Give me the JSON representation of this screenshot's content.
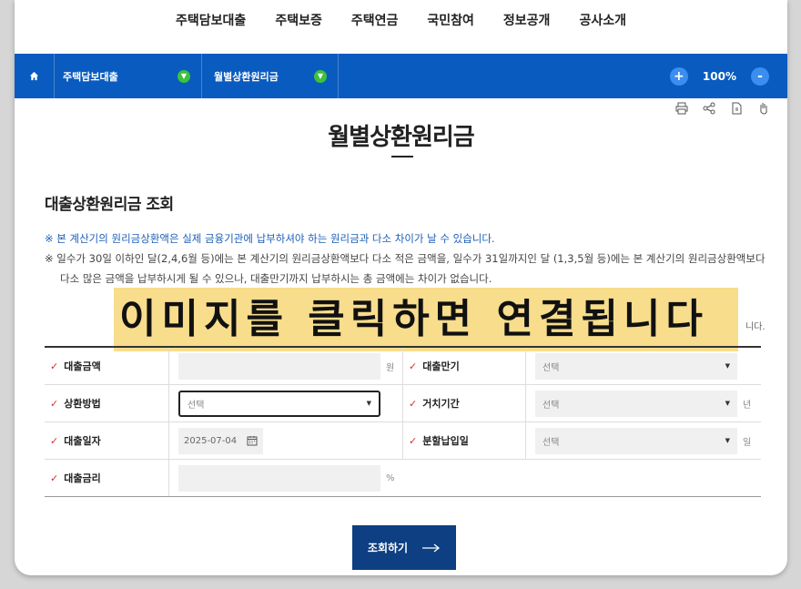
{
  "topnav": [
    "주택담보대출",
    "주택보증",
    "주택연금",
    "국민참여",
    "정보공개",
    "공사소개"
  ],
  "breadcrumb": {
    "item1": "주택담보대출",
    "item2": "월별상환원리금"
  },
  "zoom": {
    "level": "100%",
    "plus": "+",
    "minus": "-"
  },
  "page_title": "월별상환원리금",
  "section_title": "대출상환원리금 조회",
  "notes": {
    "note1": "※ 본 계산기의 원리금상환액은 실제 금융기관에 납부하셔야 하는 원리금과 다소 차이가 날 수 있습니다.",
    "note2_line1": "※ 일수가 30일 이하인 달(2,4,6월 등)에는 본 계산기의 원리금상환액보다 다소 적은 금액을, 일수가 31일까지인 달 (1,3,5월 등)에는 본 계산기의 원리금상환액보다",
    "note2_line2": "다소 많은 금액을 납부하시게 될 수 있으나, 대출만기까지 납부하시는 총 금액에는 차이가 없습니다."
  },
  "banner_text": "이미지를 클릭하면 연결됩니다",
  "behind_banner_tail": "니다.",
  "form": {
    "loan_amount_label": "대출금액",
    "loan_amount_unit": "원",
    "loan_term_label": "대출만기",
    "loan_term_value": "선택",
    "repay_method_label": "상환방법",
    "repay_method_value": "선택",
    "grace_label": "거치기간",
    "grace_value": "선택",
    "grace_unit": "년",
    "loan_date_label": "대출일자",
    "loan_date_value": "2025-07-04",
    "pay_day_label": "분할납입일",
    "pay_day_value": "선택",
    "pay_day_unit": "일",
    "rate_label": "대출금리",
    "rate_unit": "%"
  },
  "submit_label": "조회하기",
  "icons": [
    "home-icon",
    "print-icon",
    "share-icon",
    "pdf-icon",
    "hand-icon",
    "chevron-down-icon",
    "calendar-icon",
    "arrow-right-icon"
  ]
}
